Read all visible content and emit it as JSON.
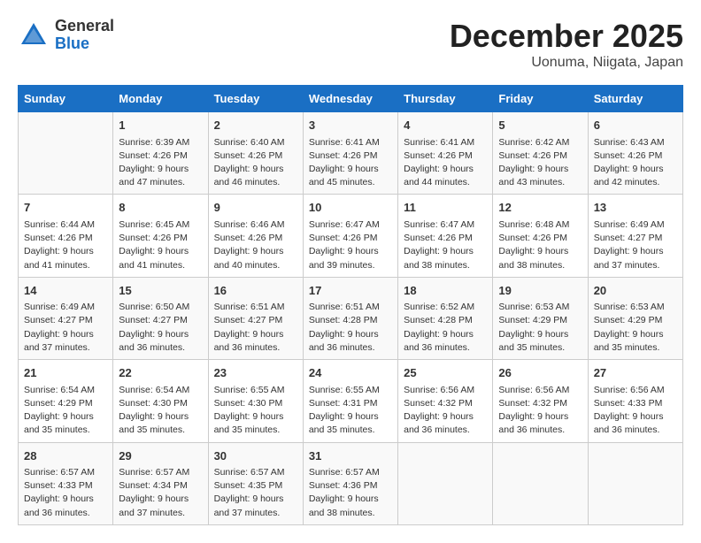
{
  "header": {
    "logo_general": "General",
    "logo_blue": "Blue",
    "month": "December 2025",
    "location": "Uonuma, Niigata, Japan"
  },
  "weekdays": [
    "Sunday",
    "Monday",
    "Tuesday",
    "Wednesday",
    "Thursday",
    "Friday",
    "Saturday"
  ],
  "weeks": [
    [
      {
        "num": "",
        "info": ""
      },
      {
        "num": "1",
        "info": "Sunrise: 6:39 AM\nSunset: 4:26 PM\nDaylight: 9 hours\nand 47 minutes."
      },
      {
        "num": "2",
        "info": "Sunrise: 6:40 AM\nSunset: 4:26 PM\nDaylight: 9 hours\nand 46 minutes."
      },
      {
        "num": "3",
        "info": "Sunrise: 6:41 AM\nSunset: 4:26 PM\nDaylight: 9 hours\nand 45 minutes."
      },
      {
        "num": "4",
        "info": "Sunrise: 6:41 AM\nSunset: 4:26 PM\nDaylight: 9 hours\nand 44 minutes."
      },
      {
        "num": "5",
        "info": "Sunrise: 6:42 AM\nSunset: 4:26 PM\nDaylight: 9 hours\nand 43 minutes."
      },
      {
        "num": "6",
        "info": "Sunrise: 6:43 AM\nSunset: 4:26 PM\nDaylight: 9 hours\nand 42 minutes."
      }
    ],
    [
      {
        "num": "7",
        "info": "Sunrise: 6:44 AM\nSunset: 4:26 PM\nDaylight: 9 hours\nand 41 minutes."
      },
      {
        "num": "8",
        "info": "Sunrise: 6:45 AM\nSunset: 4:26 PM\nDaylight: 9 hours\nand 41 minutes."
      },
      {
        "num": "9",
        "info": "Sunrise: 6:46 AM\nSunset: 4:26 PM\nDaylight: 9 hours\nand 40 minutes."
      },
      {
        "num": "10",
        "info": "Sunrise: 6:47 AM\nSunset: 4:26 PM\nDaylight: 9 hours\nand 39 minutes."
      },
      {
        "num": "11",
        "info": "Sunrise: 6:47 AM\nSunset: 4:26 PM\nDaylight: 9 hours\nand 38 minutes."
      },
      {
        "num": "12",
        "info": "Sunrise: 6:48 AM\nSunset: 4:26 PM\nDaylight: 9 hours\nand 38 minutes."
      },
      {
        "num": "13",
        "info": "Sunrise: 6:49 AM\nSunset: 4:27 PM\nDaylight: 9 hours\nand 37 minutes."
      }
    ],
    [
      {
        "num": "14",
        "info": "Sunrise: 6:49 AM\nSunset: 4:27 PM\nDaylight: 9 hours\nand 37 minutes."
      },
      {
        "num": "15",
        "info": "Sunrise: 6:50 AM\nSunset: 4:27 PM\nDaylight: 9 hours\nand 36 minutes."
      },
      {
        "num": "16",
        "info": "Sunrise: 6:51 AM\nSunset: 4:27 PM\nDaylight: 9 hours\nand 36 minutes."
      },
      {
        "num": "17",
        "info": "Sunrise: 6:51 AM\nSunset: 4:28 PM\nDaylight: 9 hours\nand 36 minutes."
      },
      {
        "num": "18",
        "info": "Sunrise: 6:52 AM\nSunset: 4:28 PM\nDaylight: 9 hours\nand 36 minutes."
      },
      {
        "num": "19",
        "info": "Sunrise: 6:53 AM\nSunset: 4:29 PM\nDaylight: 9 hours\nand 35 minutes."
      },
      {
        "num": "20",
        "info": "Sunrise: 6:53 AM\nSunset: 4:29 PM\nDaylight: 9 hours\nand 35 minutes."
      }
    ],
    [
      {
        "num": "21",
        "info": "Sunrise: 6:54 AM\nSunset: 4:29 PM\nDaylight: 9 hours\nand 35 minutes."
      },
      {
        "num": "22",
        "info": "Sunrise: 6:54 AM\nSunset: 4:30 PM\nDaylight: 9 hours\nand 35 minutes."
      },
      {
        "num": "23",
        "info": "Sunrise: 6:55 AM\nSunset: 4:30 PM\nDaylight: 9 hours\nand 35 minutes."
      },
      {
        "num": "24",
        "info": "Sunrise: 6:55 AM\nSunset: 4:31 PM\nDaylight: 9 hours\nand 35 minutes."
      },
      {
        "num": "25",
        "info": "Sunrise: 6:56 AM\nSunset: 4:32 PM\nDaylight: 9 hours\nand 36 minutes."
      },
      {
        "num": "26",
        "info": "Sunrise: 6:56 AM\nSunset: 4:32 PM\nDaylight: 9 hours\nand 36 minutes."
      },
      {
        "num": "27",
        "info": "Sunrise: 6:56 AM\nSunset: 4:33 PM\nDaylight: 9 hours\nand 36 minutes."
      }
    ],
    [
      {
        "num": "28",
        "info": "Sunrise: 6:57 AM\nSunset: 4:33 PM\nDaylight: 9 hours\nand 36 minutes."
      },
      {
        "num": "29",
        "info": "Sunrise: 6:57 AM\nSunset: 4:34 PM\nDaylight: 9 hours\nand 37 minutes."
      },
      {
        "num": "30",
        "info": "Sunrise: 6:57 AM\nSunset: 4:35 PM\nDaylight: 9 hours\nand 37 minutes."
      },
      {
        "num": "31",
        "info": "Sunrise: 6:57 AM\nSunset: 4:36 PM\nDaylight: 9 hours\nand 38 minutes."
      },
      {
        "num": "",
        "info": ""
      },
      {
        "num": "",
        "info": ""
      },
      {
        "num": "",
        "info": ""
      }
    ]
  ]
}
